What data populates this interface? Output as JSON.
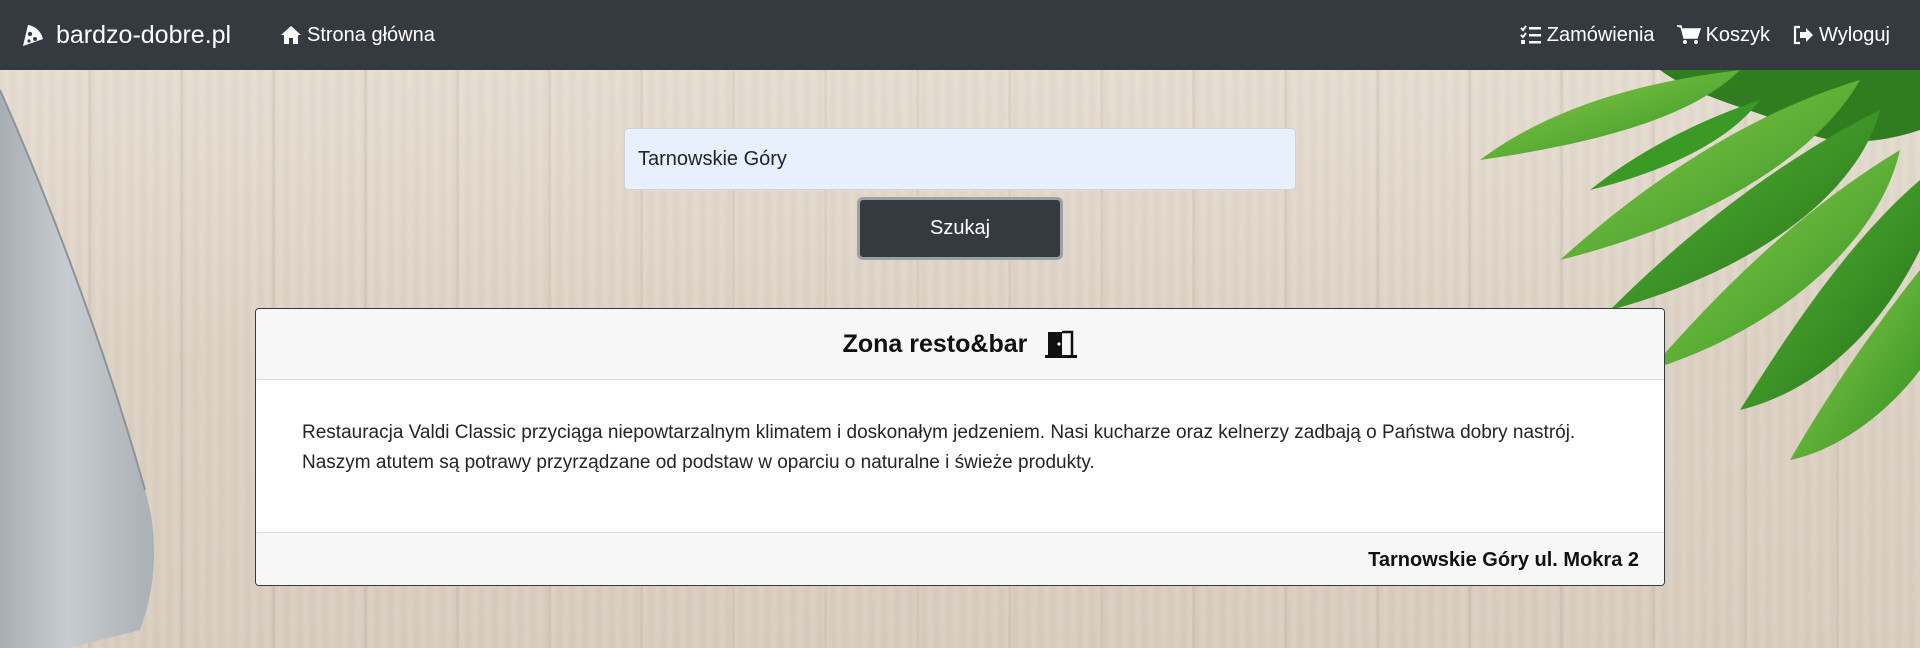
{
  "navbar": {
    "brand": "bardzo-dobre.pl",
    "brand_icon": "pizza-slice-icon",
    "home_label": "Strona główna",
    "home_icon": "home-icon",
    "orders_label": "Zamówienia",
    "orders_icon": "list-check-icon",
    "cart_label": "Koszyk",
    "cart_icon": "shopping-cart-icon",
    "logout_label": "Wyloguj",
    "logout_icon": "sign-out-icon"
  },
  "search": {
    "value": "Tarnowskie Góry",
    "button_label": "Szukaj"
  },
  "restaurant": {
    "name": "Zona resto&bar",
    "status_icon": "door-open-icon",
    "description": "Restauracja Valdi Classic przyciąga niepowtarzalnym klimatem i doskonałym jedzeniem. Nasi kucharze oraz kelnerzy zadbają o Państwa dobry nastrój. Naszym atutem są potrawy przyrządzane od podstaw w oparciu o naturalne i świeże produkty.",
    "address": "Tarnowskie Góry ul. Mokra 2"
  },
  "colors": {
    "navbar_bg": "#343a40",
    "input_bg": "#e8f0fe",
    "button_bg": "#343a40"
  }
}
